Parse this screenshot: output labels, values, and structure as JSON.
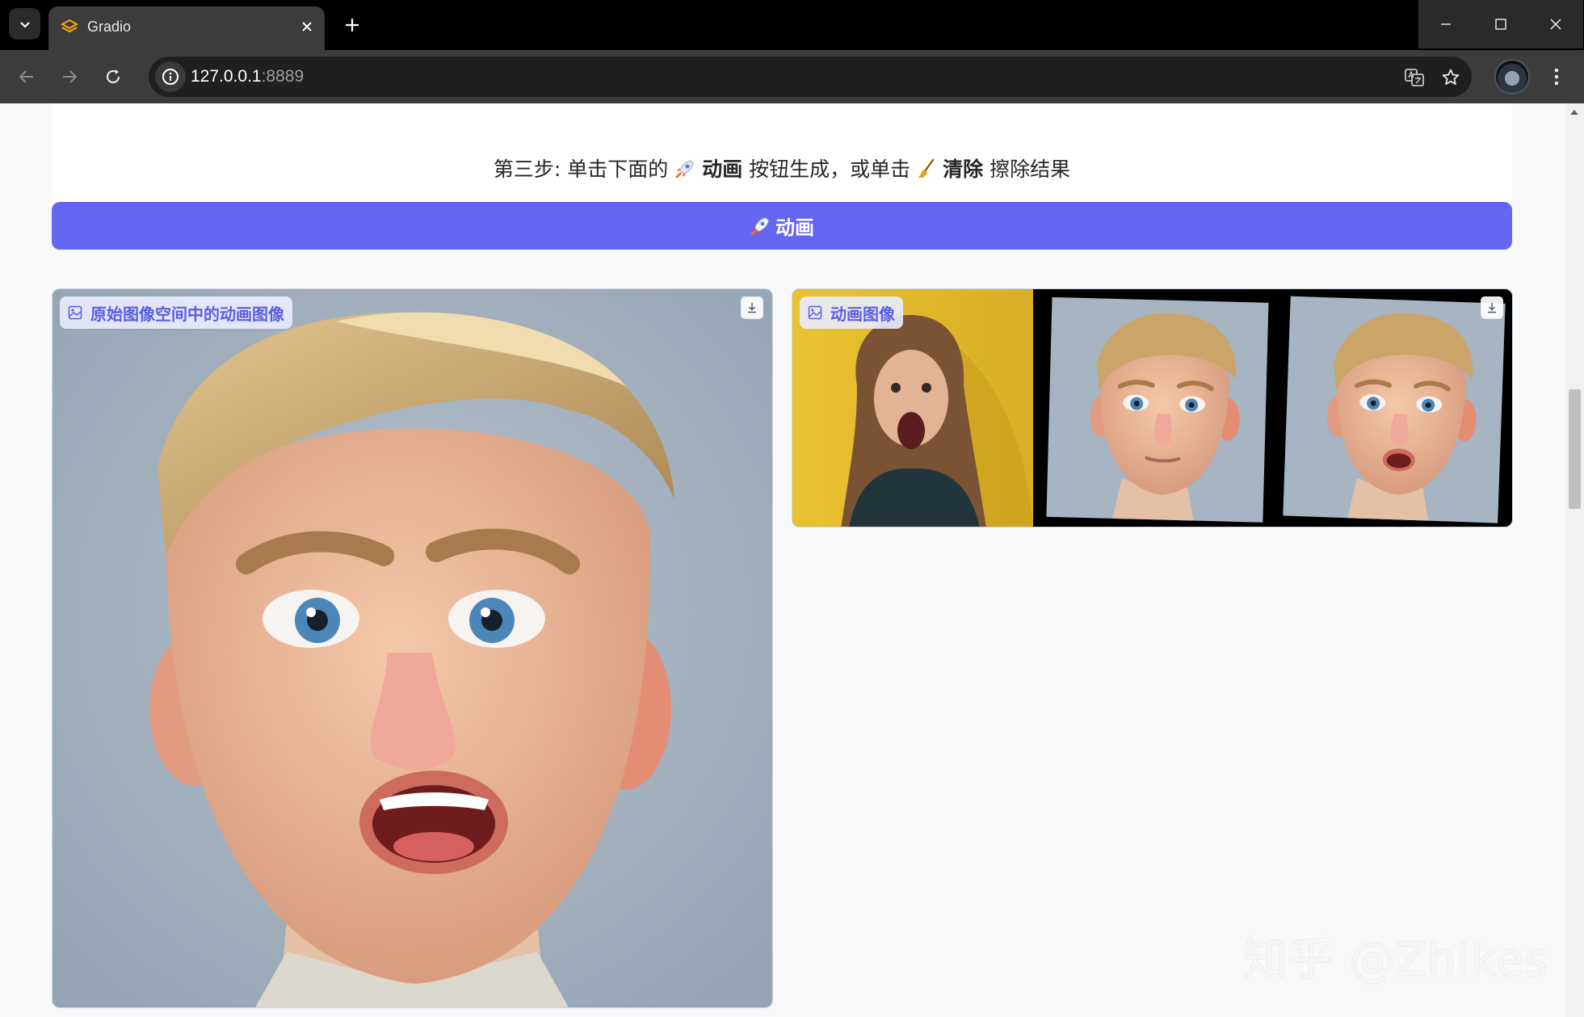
{
  "browser": {
    "tab_title": "Gradio",
    "url_host": "127.0.0.1",
    "url_port": ":8889"
  },
  "page": {
    "instruction_prefix": "第三步: 单击下面的",
    "instruction_animate": "动画",
    "instruction_middle": "按钮生成，或单击",
    "instruction_clear": "清除",
    "instruction_suffix": "擦除结果",
    "animate_button_label": "动画",
    "left_panel_label": "原始图像空间中的动画图像",
    "right_panel_label": "动画图像"
  },
  "watermark": "知乎 @Zhikes",
  "colors": {
    "accent": "#6366f1",
    "label_text": "#5b5fe0"
  },
  "icons": [
    "chevron-down-icon",
    "gradio-logo-icon",
    "close-icon",
    "plus-icon",
    "arrow-left-icon",
    "arrow-right-icon",
    "reload-icon",
    "info-icon",
    "translate-icon",
    "star-icon",
    "more-vertical-icon",
    "rocket-icon",
    "broom-icon",
    "image-icon",
    "download-icon"
  ]
}
